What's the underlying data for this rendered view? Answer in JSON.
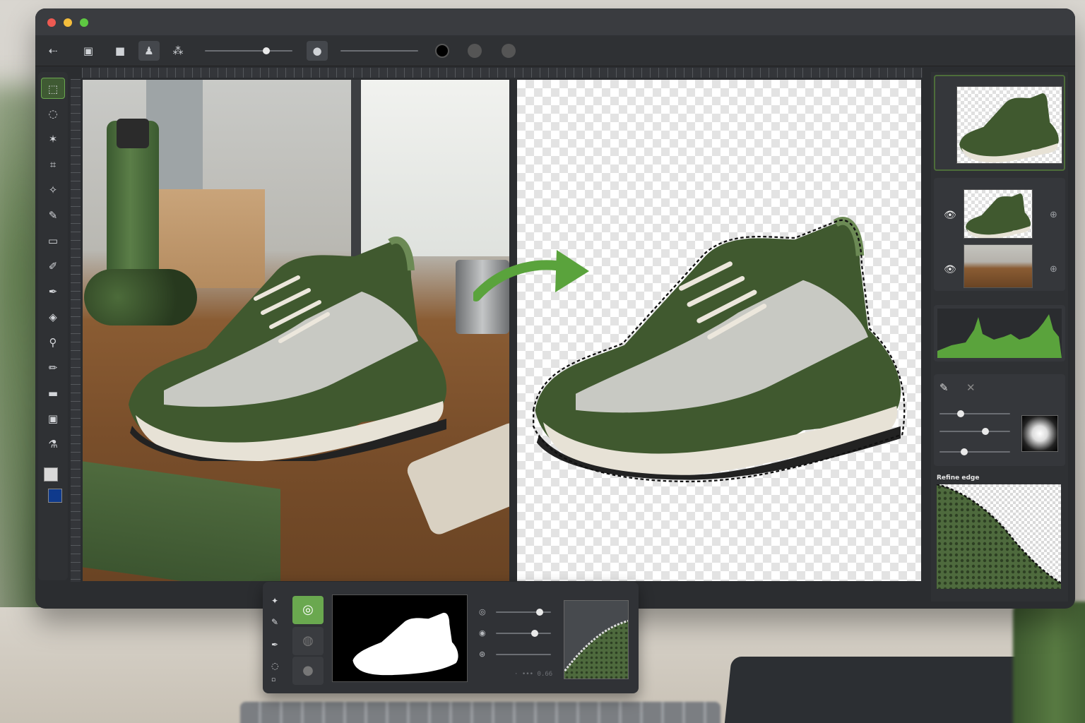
{
  "window": {
    "traffic_lights": [
      "close",
      "minimize",
      "maximize"
    ]
  },
  "options_bar": {
    "back_icon": "arrow-left-icon",
    "mode_buttons": [
      "new-selection-icon",
      "add-selection-icon",
      "subject-select-icon",
      "object-select-icon"
    ],
    "active_mode_index": 2,
    "brush_size_fraction": 0.7,
    "feather_fraction": 0.5,
    "colors": [
      "#000000",
      "#555555",
      "#555555"
    ]
  },
  "tools": {
    "items": [
      {
        "name": "marquee",
        "glyph": "⬚"
      },
      {
        "name": "lasso",
        "glyph": "◌"
      },
      {
        "name": "magic-wand",
        "glyph": "✶"
      },
      {
        "name": "crop",
        "glyph": "⌗"
      },
      {
        "name": "quick-select",
        "glyph": "✧"
      },
      {
        "name": "brush",
        "glyph": "✎"
      },
      {
        "name": "eraser",
        "glyph": "▭"
      },
      {
        "name": "pencil",
        "glyph": "✐"
      },
      {
        "name": "pen",
        "glyph": "✒"
      },
      {
        "name": "fill",
        "glyph": "◈"
      },
      {
        "name": "stamp",
        "glyph": "⚲"
      },
      {
        "name": "smudge",
        "glyph": "✏"
      },
      {
        "name": "rectangle",
        "glyph": "▬"
      },
      {
        "name": "image",
        "glyph": "▣"
      },
      {
        "name": "eyedropper",
        "glyph": "⚗"
      }
    ],
    "active_index": 0,
    "foreground_color": "#d9d9d9",
    "background_color": "#0f3a8c"
  },
  "layers": {
    "layer_1": {
      "visible_icon": "eye-icon",
      "lock_icon": "lock-icon"
    },
    "layer_2": {
      "visible_icon": "eye-icon",
      "lock_icon": "lock-icon"
    }
  },
  "histogram": {
    "color": "#5aa33c"
  },
  "refine": {
    "label": "Refine edge",
    "sliders": [
      0.3,
      0.65,
      0.35
    ]
  },
  "floating_panel": {
    "tools": [
      "sparkle-icon",
      "brush-icon",
      "pen-icon",
      "lasso-icon",
      "camera-icon"
    ],
    "buttons": [
      {
        "name": "select-subject",
        "glyph": "◎",
        "active": true
      },
      {
        "name": "background-select",
        "glyph": "◍",
        "active": false
      },
      {
        "name": "circle-select",
        "glyph": "●",
        "active": false
      }
    ],
    "sliders": [
      0.8,
      0.7,
      0.0
    ],
    "footer_text": "· ••• 0.66",
    "accent": "#6aa84f"
  }
}
